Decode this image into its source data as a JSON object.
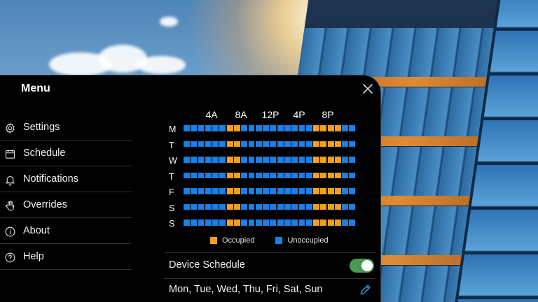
{
  "panel": {
    "title": "Menu",
    "close_icon": "close-icon"
  },
  "nav": {
    "items": [
      {
        "label": "Settings",
        "icon": "gear-icon"
      },
      {
        "label": "Schedule",
        "icon": "calendar-icon"
      },
      {
        "label": "Notifications",
        "icon": "bell-icon"
      },
      {
        "label": "Overrides",
        "icon": "hand-icon"
      },
      {
        "label": "About",
        "icon": "info-icon"
      },
      {
        "label": "Help",
        "icon": "question-icon"
      }
    ]
  },
  "schedule": {
    "hour_labels": [
      "4A",
      "8A",
      "12P",
      "4P",
      "8P"
    ],
    "days": [
      "M",
      "T",
      "W",
      "T",
      "F",
      "S",
      "S"
    ],
    "slots_per_day": 24,
    "occupied_slots": [
      6,
      7,
      18,
      19,
      20,
      21
    ],
    "legend": {
      "occupied_label": "Occupied",
      "unoccupied_label": "Unoccupied"
    },
    "colors": {
      "occupied": "#f0a01e",
      "unoccupied": "#1a7fe6"
    }
  },
  "device_schedule": {
    "label": "Device Schedule",
    "enabled": true,
    "toggle_color": "#4a9a52"
  },
  "active_days": {
    "label": "Mon, Tue, Wed, Thu, Fri, Sat, Sun",
    "edit_icon": "pencil-icon",
    "edit_color": "#2f8fe0"
  }
}
